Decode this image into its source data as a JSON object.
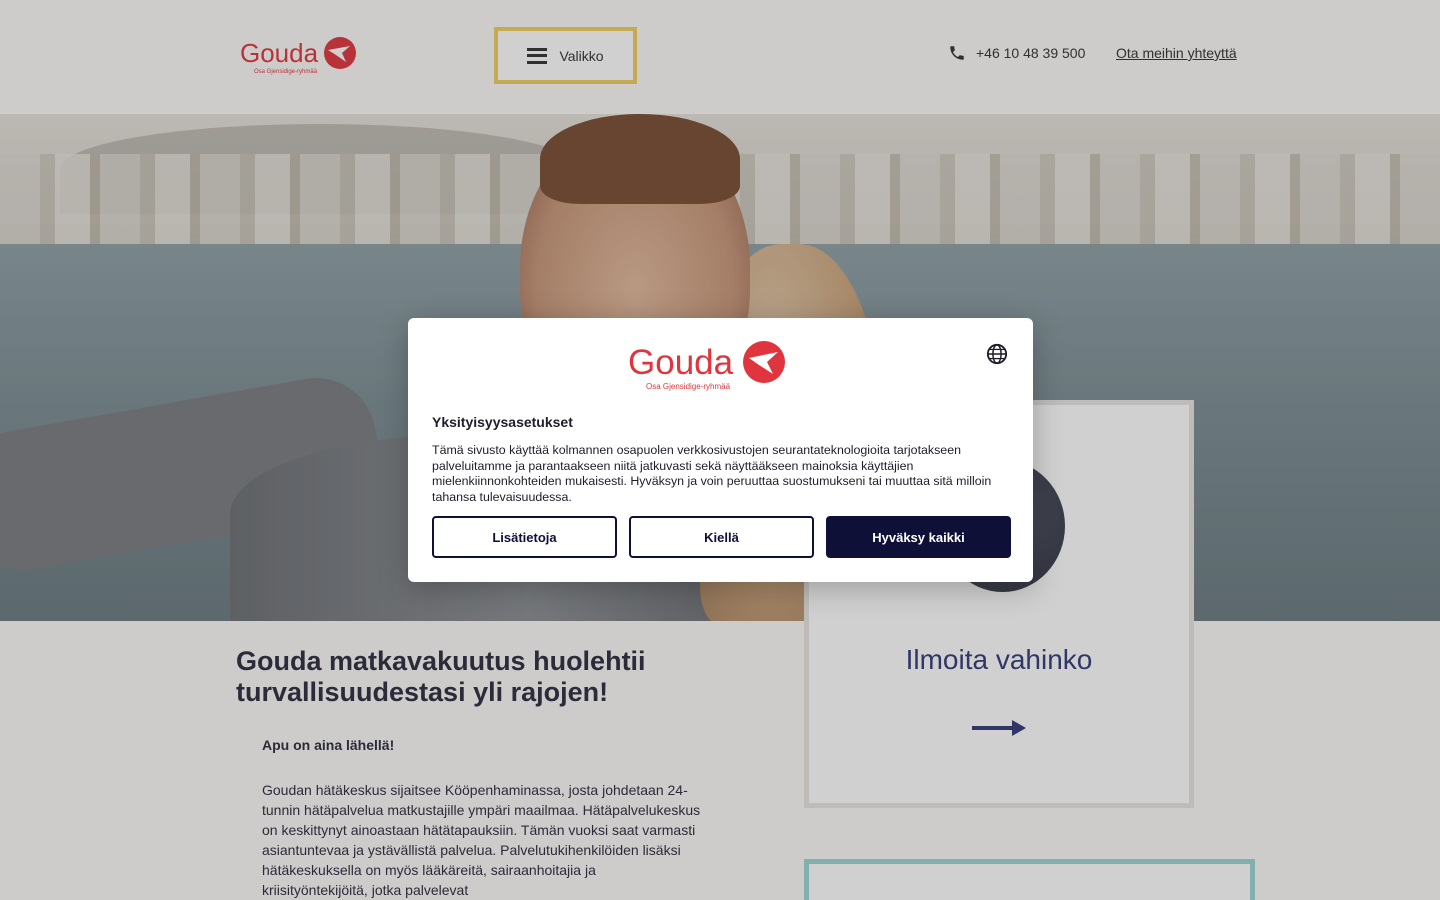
{
  "header": {
    "logo_text": "Gouda",
    "logo_sub": "Osa Gjensidige-ryhmää",
    "menu_label": "Valikko",
    "phone": "+46 10 48 39 500",
    "contact_link": "Ota meihin yhteyttä"
  },
  "main": {
    "headline": "Gouda matkavakuutus huolehtii turvallisuudestasi yli rajojen!",
    "sub": "Apu on aina lähellä!",
    "paragraph": "Goudan hätäkeskus sijaitsee Kööpenhaminassa, josta johdetaan 24-tunnin hätäpalvelua matkustajille ympäri maailmaa. Hätäpalvelukeskus on keskittynyt ainoastaan hätätapauksiin. Tämän vuoksi saat varmasti asiantuntevaa ja ystävällistä palvelua. Palvelutukihenkilöiden lisäksi hätäkeskuksella on myös lääkäreitä, sairaanhoitajia ja kriisityöntekijöitä, jotka palvelevat",
    "claim_title": "Ilmoita vahinko"
  },
  "consent": {
    "title": "Yksityisyysasetukset",
    "text": "Tämä sivusto käyttää kolmannen osapuolen verkkosivustojen seurantateknologioita tarjotakseen palveluitamme ja parantaakseen niitä jatkuvasti sekä näyttääkseen mainoksia käyttäjien mielenkiinnonkohteiden mukaisesti. Hyväksyn ja voin peruuttaa suostumukseni tai muuttaa sitä milloin tahansa tulevaisuudessa.",
    "btn_more": "Lisätietoja",
    "btn_deny": "Kiellä",
    "btn_accept": "Hyväksy kaikki"
  },
  "colors": {
    "brand_red": "#e0353e",
    "navy": "#0f1038",
    "menu_border": "#f3cf5f",
    "accent_teal": "#9cd8d3",
    "claim_blue": "#333a78"
  }
}
